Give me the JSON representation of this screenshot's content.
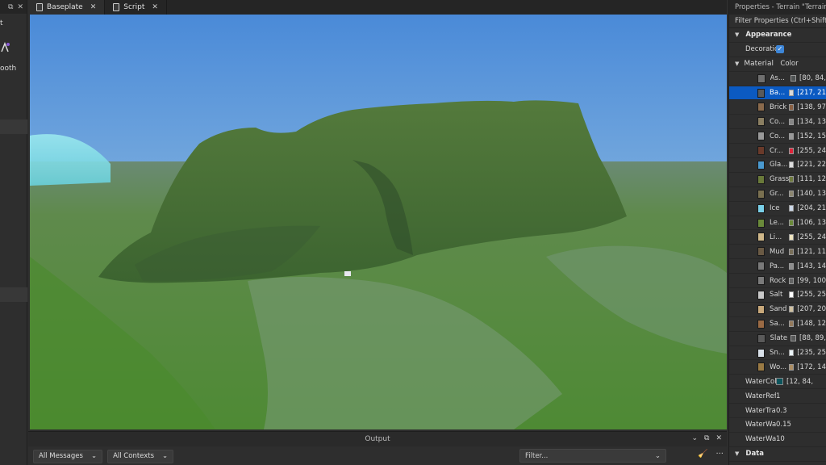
{
  "left_panel": {
    "header_icons": [
      "pin-icon",
      "close-icon"
    ],
    "fragments": [
      "t",
      "ooth"
    ]
  },
  "tabs": [
    {
      "label": "Baseplate",
      "icon": "place-icon",
      "active": true
    },
    {
      "label": "Script",
      "icon": "script-icon",
      "active": false
    }
  ],
  "output": {
    "title": "Output",
    "messages_filter": "All Messages",
    "contexts_filter": "All Contexts",
    "filter_placeholder": "Filter...",
    "more": "···"
  },
  "properties": {
    "title": "Properties - Terrain \"Terrain\"",
    "filter_placeholder": "Filter Properties (Ctrl+Shift+P)",
    "appearance_label": "Appearance",
    "decoration_label": "Decoration",
    "decoration_checked": true,
    "material_label": "Material",
    "color_column": "Color",
    "materials": [
      {
        "name": "As...",
        "value": "[80, 84,",
        "thumb": "#6f6f6f",
        "color": "#505454"
      },
      {
        "name": "Ba...",
        "value": "[217, 21",
        "thumb": "#5a5a5a",
        "color": "#d9d9d9",
        "selected": true
      },
      {
        "name": "Brick",
        "value": "[138, 97",
        "thumb": "#8a6a4c",
        "color": "#8a6144"
      },
      {
        "name": "Co...",
        "value": "[134, 13",
        "thumb": "#8b7f62",
        "color": "#868686"
      },
      {
        "name": "Co...",
        "value": "[152, 15",
        "thumb": "#9a9a9a",
        "color": "#989898"
      },
      {
        "name": "Cr...",
        "value": "[255, 24",
        "thumb": "#6a3a2a",
        "color": "#e0243a"
      },
      {
        "name": "Gla...",
        "value": "[221, 22",
        "thumb": "#4a9ad0",
        "color": "#dddddd"
      },
      {
        "name": "Grass",
        "value": "[111, 12",
        "thumb": "#6a7a3a",
        "color": "#6f7a3f"
      },
      {
        "name": "Gr...",
        "value": "[140, 13",
        "thumb": "#7a7050",
        "color": "#8c8670"
      },
      {
        "name": "Ice",
        "value": "[204, 21",
        "thumb": "#7ad0e8",
        "color": "#ccd8e8"
      },
      {
        "name": "Le...",
        "value": "[106, 13",
        "thumb": "#6a8a3a",
        "color": "#6a8a3a"
      },
      {
        "name": "Li...",
        "value": "[255, 24",
        "thumb": "#d0b88a",
        "color": "#f0e6c0"
      },
      {
        "name": "Mud",
        "value": "[121, 11",
        "thumb": "#6a5a44",
        "color": "#79705a"
      },
      {
        "name": "Pa...",
        "value": "[143, 14",
        "thumb": "#7a7a7a",
        "color": "#8f8f8f"
      },
      {
        "name": "Rock",
        "value": "[99, 100",
        "thumb": "#7a7a7a",
        "color": "#636464"
      },
      {
        "name": "Salt",
        "value": "[255, 25",
        "thumb": "#c8c8c8",
        "color": "#ffffff"
      },
      {
        "name": "Sand",
        "value": "[207, 20",
        "thumb": "#c8a87a",
        "color": "#cfc0a0"
      },
      {
        "name": "Sa...",
        "value": "[148, 12",
        "thumb": "#9a6a44",
        "color": "#947a5c"
      },
      {
        "name": "Slate",
        "value": "[88, 89,",
        "thumb": "#5a5a5a",
        "color": "#585959"
      },
      {
        "name": "Sn...",
        "value": "[235, 25",
        "thumb": "#d8e0e8",
        "color": "#ebf4f8"
      },
      {
        "name": "Wo...",
        "value": "[172, 14",
        "thumb": "#9a7a44",
        "color": "#ac8e64"
      }
    ],
    "water_color_label": "WaterColor",
    "water_color_value": "[12, 84,",
    "water_color_swatch": "#0c545c",
    "water_reflectance_label": "WaterRefle...",
    "water_reflectance_value": "1",
    "water_transparency_label": "WaterTrans...",
    "water_transparency_value": "0.3",
    "water_wave_size_label": "WaterWave...",
    "water_wave_size_value": "0.15",
    "water_wave_speed_label": "WaterWave...",
    "water_wave_speed_value": "10",
    "data_label": "Data"
  }
}
